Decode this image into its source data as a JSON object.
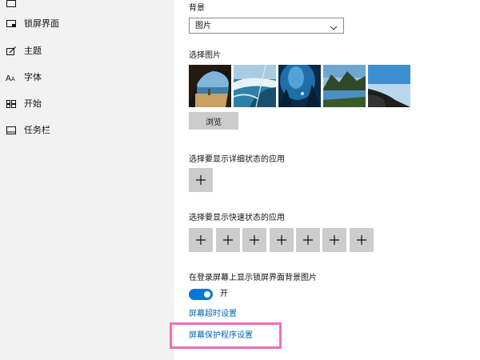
{
  "sidebar": {
    "items": [
      {
        "label": "",
        "icon": "background-icon"
      },
      {
        "label": "锁屏界面",
        "icon": "lock-screen-icon"
      },
      {
        "label": "主题",
        "icon": "theme-icon"
      },
      {
        "label": "字体",
        "icon": "font-icon"
      },
      {
        "label": "开始",
        "icon": "start-icon"
      },
      {
        "label": "任务栏",
        "icon": "taskbar-icon"
      }
    ]
  },
  "main": {
    "background_label": "背景",
    "background_select": {
      "value": "图片"
    },
    "choose_picture_label": "选择图片",
    "pictures": [
      {
        "name": "cave-beach"
      },
      {
        "name": "waves-aerial"
      },
      {
        "name": "underwater-diver"
      },
      {
        "name": "mountain-lake"
      },
      {
        "name": "hillside-sky"
      }
    ],
    "browse_label": "浏览",
    "detailed_status_label": "选择要显示详细状态的应用",
    "detailed_status_slots": 1,
    "quick_status_label": "选择要显示快速状态的应用",
    "quick_status_slots": 7,
    "show_bg_label": "在登录屏幕上显示锁屏界面背景图片",
    "show_bg_toggle": {
      "state": "开",
      "on": true
    },
    "screen_timeout_link": "屏幕超时设置",
    "screensaver_link": "屏幕保护程序设置"
  },
  "colors": {
    "accent": "#0078d7",
    "link": "#0067b8",
    "highlight": "#f06fb4",
    "sidebar_bg": "#f2f2f2",
    "button_bg": "#cccccc"
  }
}
